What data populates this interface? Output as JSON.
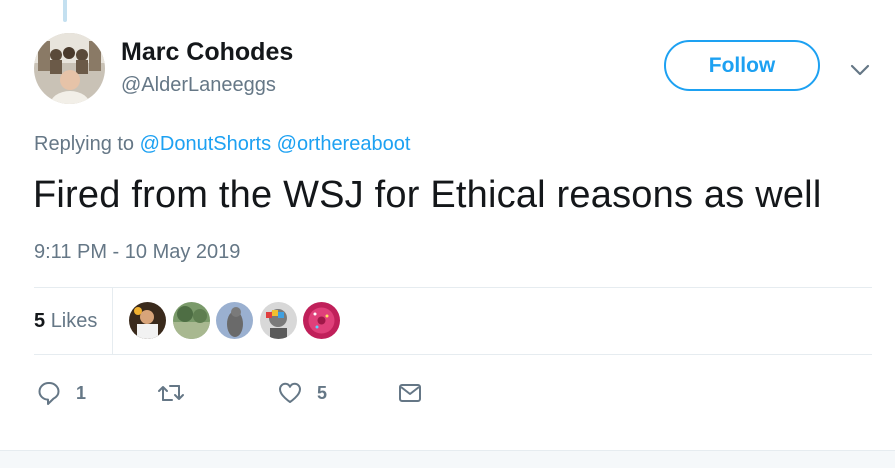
{
  "tweet": {
    "author_name": "Marc Cohodes",
    "author_handle": "@AlderLaneeggs",
    "follow_label": "Follow",
    "replying_prefix": "Replying to",
    "replying_mentions": [
      "@DonutShorts",
      "@orthereaboot"
    ],
    "text": "Fired from the WSJ for Ethical reasons as well",
    "timestamp": "9:11 PM - 10 May 2019"
  },
  "stats": {
    "likes_count": "5",
    "likes_label": "Likes"
  },
  "actions": {
    "reply_count": "1",
    "like_count": "5"
  },
  "icons": {
    "caret": "chevron-down-icon",
    "reply": "reply-icon",
    "retweet": "retweet-icon",
    "like": "heart-icon",
    "message": "envelope-icon"
  },
  "colors": {
    "accent": "#1da1f2",
    "secondary_text": "#657786",
    "primary_text": "#14171a",
    "divider": "#e6ecf0"
  }
}
